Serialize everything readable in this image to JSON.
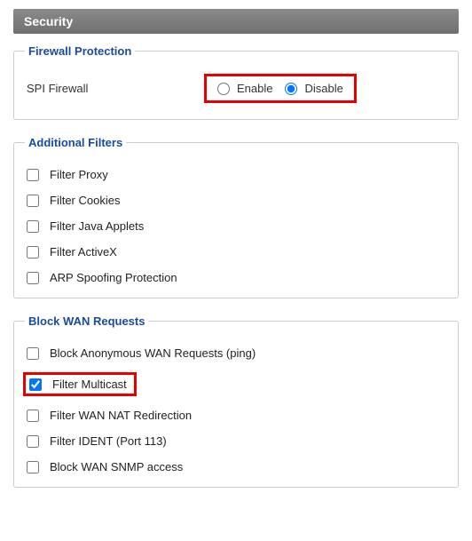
{
  "header": {
    "title": "Security"
  },
  "firewall": {
    "legend": "Firewall Protection",
    "spi_label": "SPI Firewall",
    "enable_label": "Enable",
    "disable_label": "Disable",
    "selected": "disable"
  },
  "filters": {
    "legend": "Additional Filters",
    "items": [
      {
        "label": "Filter Proxy",
        "checked": false
      },
      {
        "label": "Filter Cookies",
        "checked": false
      },
      {
        "label": "Filter Java Applets",
        "checked": false
      },
      {
        "label": "Filter ActiveX",
        "checked": false
      },
      {
        "label": "ARP Spoofing Protection",
        "checked": false
      }
    ]
  },
  "wan": {
    "legend": "Block WAN Requests",
    "items": [
      {
        "label": "Block Anonymous WAN Requests (ping)",
        "checked": false,
        "highlight": false
      },
      {
        "label": "Filter Multicast",
        "checked": true,
        "highlight": true
      },
      {
        "label": "Filter WAN NAT Redirection",
        "checked": false,
        "highlight": false
      },
      {
        "label": "Filter IDENT (Port 113)",
        "checked": false,
        "highlight": false
      },
      {
        "label": "Block WAN SNMP access",
        "checked": false,
        "highlight": false
      }
    ]
  }
}
